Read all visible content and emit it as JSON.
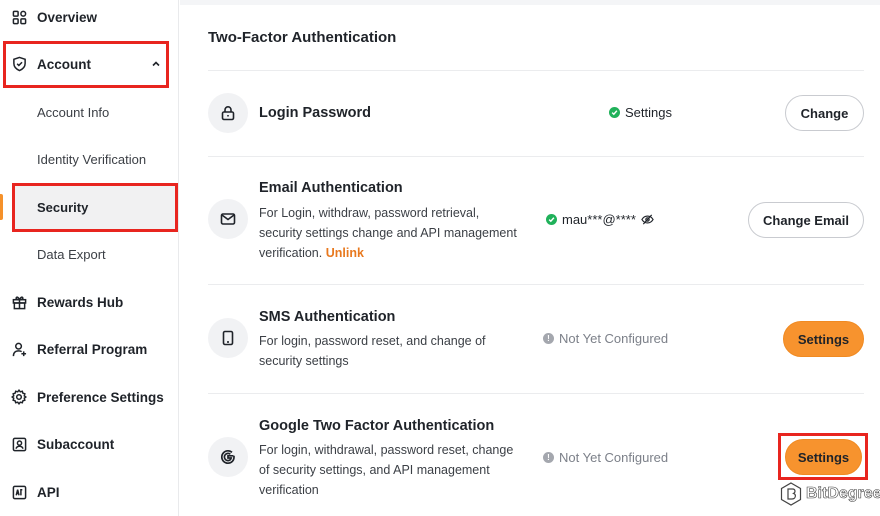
{
  "sidebar": {
    "overview": "Overview",
    "account": "Account",
    "account_children": [
      "Account Info",
      "Identity Verification",
      "Security",
      "Data Export"
    ],
    "rewards": "Rewards Hub",
    "referral": "Referral Program",
    "preference": "Preference Settings",
    "subaccount": "Subaccount",
    "api": "API"
  },
  "main": {
    "title": "Two-Factor Authentication",
    "rows": [
      {
        "title": "Login Password",
        "status": "Settings",
        "button": "Change"
      },
      {
        "title": "Email Authentication",
        "desc": "For Login, withdraw, password retrieval, security settings change and API management verification.",
        "link": "Unlink",
        "status": "mau***@****",
        "button": "Change Email"
      },
      {
        "title": "SMS Authentication",
        "desc": "For login, password reset, and change of security settings",
        "status": "Not Yet Configured",
        "button": "Settings"
      },
      {
        "title": "Google Two Factor Authentication",
        "desc": "For login, withdrawal, password reset, change of security settings, and API management verification",
        "status": "Not Yet Configured",
        "button": "Settings"
      }
    ]
  },
  "watermark": "BitDegree",
  "colors": {
    "accent": "#f7932e",
    "highlight": "#e8251f",
    "success": "#20b15a",
    "link": "#e8791f"
  }
}
